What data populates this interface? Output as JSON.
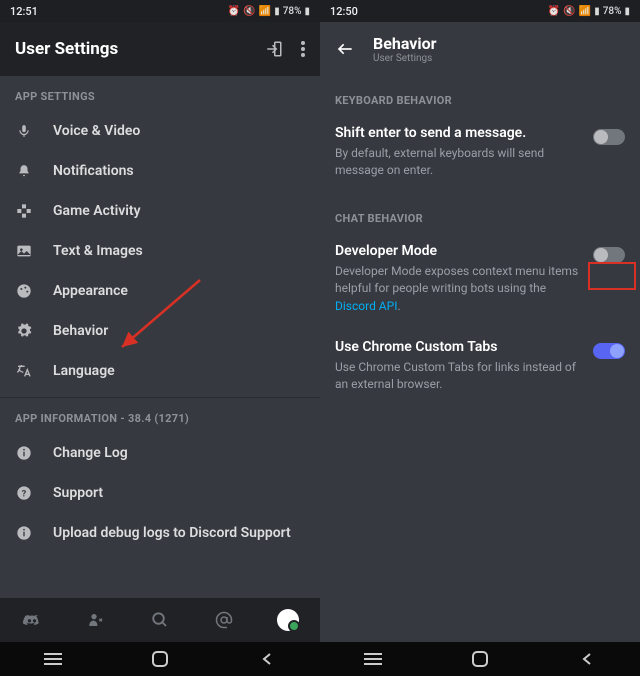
{
  "left": {
    "status": {
      "time": "12:51",
      "battery": "78%"
    },
    "header": {
      "title": "User Settings"
    },
    "section1": "APP SETTINGS",
    "items": [
      {
        "icon": "mic-icon",
        "label": "Voice & Video"
      },
      {
        "icon": "bell-icon",
        "label": "Notifications"
      },
      {
        "icon": "gamepad-icon",
        "label": "Game Activity"
      },
      {
        "icon": "image-icon",
        "label": "Text & Images"
      },
      {
        "icon": "palette-icon",
        "label": "Appearance"
      },
      {
        "icon": "gear-icon",
        "label": "Behavior"
      },
      {
        "icon": "language-icon",
        "label": "Language"
      }
    ],
    "section2": "APP INFORMATION - 38.4 (1271)",
    "items2": [
      {
        "icon": "info-icon",
        "label": "Change Log"
      },
      {
        "icon": "help-icon",
        "label": "Support"
      },
      {
        "icon": "info-icon",
        "label": "Upload debug logs to Discord Support"
      }
    ]
  },
  "right": {
    "status": {
      "time": "12:50",
      "battery": "78%"
    },
    "header": {
      "title": "Behavior",
      "sub": "User Settings"
    },
    "group1": "KEYBOARD BEHAVIOR",
    "shift": {
      "title": "Shift enter to send a message.",
      "desc": "By default, external keyboards will send message on enter.",
      "on": false
    },
    "group2": "CHAT BEHAVIOR",
    "dev": {
      "title": "Developer Mode",
      "desc_a": "Developer Mode exposes context menu items helpful for people writing bots using the ",
      "desc_link": "Discord API",
      "desc_b": ".",
      "on": false
    },
    "chrome": {
      "title": "Use Chrome Custom Tabs",
      "desc": "Use Chrome Custom Tabs for links instead of an external browser.",
      "on": true
    }
  }
}
